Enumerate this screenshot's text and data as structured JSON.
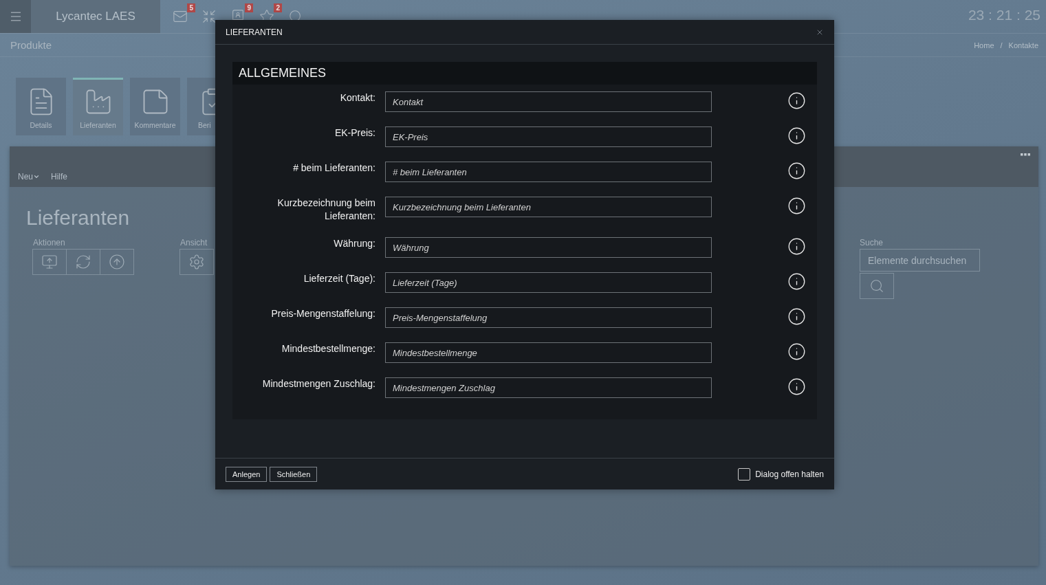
{
  "header": {
    "title": "Lycantec LAES",
    "clock": "23 : 21 : 25",
    "toolbar": [
      {
        "kind": "mail",
        "badge": "5"
      },
      {
        "kind": "collapse"
      },
      {
        "kind": "contacts",
        "badge": "9"
      },
      {
        "kind": "star",
        "badge": "2"
      },
      {
        "kind": "search"
      }
    ]
  },
  "page_title": "Produkte",
  "breadcrumb": {
    "items": [
      "Home",
      "Kontakte"
    ],
    "separator": "/"
  },
  "tiles": [
    {
      "label": "Details",
      "kind": "details",
      "selected": false
    },
    {
      "label": "Lieferanten",
      "kind": "factory",
      "selected": true
    },
    {
      "label": "Kommentare",
      "kind": "note",
      "selected": false
    },
    {
      "label": "Beri",
      "kind": "report",
      "selected": false
    }
  ],
  "panel": {
    "menu": [
      {
        "label": "Neu",
        "dropdown": true
      },
      {
        "label": "Hilfe",
        "dropdown": false
      }
    ],
    "heading": "Lieferanten",
    "actions_label": "Aktionen",
    "actions": [
      {
        "kind": "add"
      },
      {
        "kind": "refresh"
      },
      {
        "kind": "upload"
      }
    ],
    "view_label": "Ansicht",
    "view": [
      {
        "kind": "settings"
      }
    ],
    "search_label": "Suche",
    "search_placeholder": "Elemente durchsuchen"
  },
  "dialog": {
    "title": "LIEFERANTEN",
    "section": "ALLGEMEINES",
    "fields": [
      {
        "label": "Kontakt:",
        "placeholder": "Kontakt"
      },
      {
        "label": "EK-Preis:",
        "placeholder": "EK-Preis"
      },
      {
        "label": "# beim Lieferanten:",
        "placeholder": "# beim Lieferanten"
      },
      {
        "label": "Kurzbezeichnung beim Lieferanten:",
        "placeholder": "Kurzbezeichnung beim Lieferanten"
      },
      {
        "label": "Währung:",
        "placeholder": "Währung"
      },
      {
        "label": "Lieferzeit (Tage):",
        "placeholder": "Lieferzeit (Tage)"
      },
      {
        "label": "Preis-Mengenstaffelung:",
        "placeholder": "Preis-Mengenstaffelung"
      },
      {
        "label": "Mindestbestellmenge:",
        "placeholder": "Mindestbestellmenge"
      },
      {
        "label": "Mindestmengen Zuschlag:",
        "placeholder": "Mindestmengen Zuschlag"
      }
    ],
    "buttons": [
      "Anlegen",
      "Schließen"
    ],
    "keep_open": {
      "label": "Dialog offen halten",
      "checked": false
    }
  }
}
